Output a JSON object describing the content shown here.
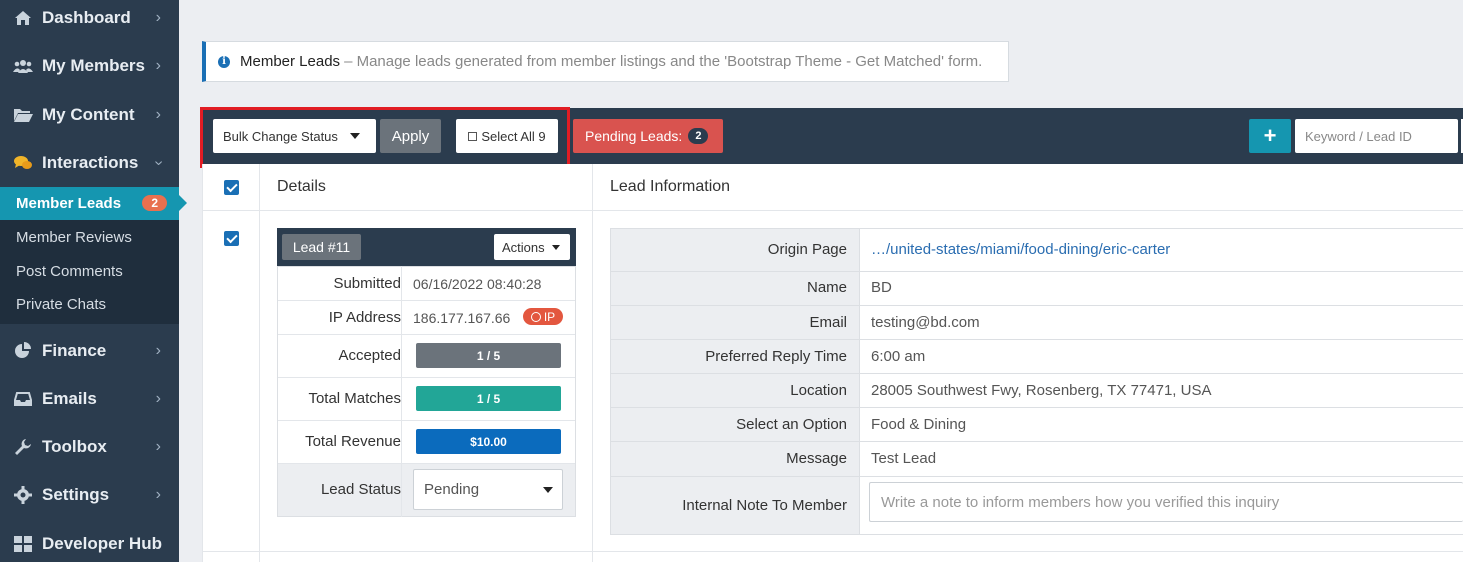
{
  "sidebar": {
    "items": [
      {
        "label": "Dashboard",
        "icon": "home-icon"
      },
      {
        "label": "My Members",
        "icon": "users-icon"
      },
      {
        "label": "My Content",
        "icon": "folder-icon"
      },
      {
        "label": "Interactions",
        "icon": "chat-icon"
      },
      {
        "label": "Finance",
        "icon": "pie-chart-icon"
      },
      {
        "label": "Emails",
        "icon": "inbox-icon"
      },
      {
        "label": "Toolbox",
        "icon": "wrench-icon"
      },
      {
        "label": "Settings",
        "icon": "gear-icon"
      },
      {
        "label": "Developer Hub",
        "icon": "grid-icon"
      }
    ],
    "submenu": [
      {
        "label": "Member Leads",
        "badge": "2"
      },
      {
        "label": "Member Reviews"
      },
      {
        "label": "Post Comments"
      },
      {
        "label": "Private Chats"
      }
    ]
  },
  "info": {
    "title": "Member Leads",
    "description": "– Manage leads generated from member listings and the 'Bootstrap Theme - Get Matched' form."
  },
  "toolbar": {
    "bulk_select": "Bulk Change Status",
    "apply": "Apply",
    "select_all": "Select All 9",
    "pending_label": "Pending Leads:",
    "pending_count": "2",
    "add": "+",
    "search_placeholder": "Keyword / Lead ID"
  },
  "table": {
    "col_details": "Details",
    "col_info": "Lead Information"
  },
  "lead": {
    "tag": "Lead #11",
    "actions": "Actions",
    "submitted_label": "Submitted",
    "submitted": "06/16/2022 08:40:28",
    "ip_label": "IP Address",
    "ip": "186.177.167.66",
    "ip_badge": "IP",
    "accepted_label": "Accepted",
    "accepted": "1 / 5",
    "matches_label": "Total Matches",
    "matches": "1 / 5",
    "revenue_label": "Total Revenue",
    "revenue": "$10.00",
    "status_label": "Lead Status",
    "status": "Pending"
  },
  "colors": {
    "accepted": "#6b737b",
    "matches": "#22a697",
    "revenue": "#0b6bbd"
  },
  "lead_info": {
    "rows": [
      {
        "label": "Origin Page",
        "value": "…/united-states/miami/food-dining/eric-carter"
      },
      {
        "label": "Name",
        "value": "BD"
      },
      {
        "label": "Email",
        "value": "testing@bd.com"
      },
      {
        "label": "Preferred Reply Time",
        "value": "6:00 am"
      },
      {
        "label": "Location",
        "value": "28005 Southwest Fwy, Rosenberg, TX 77471, USA"
      },
      {
        "label": "Select an Option",
        "value": "Food & Dining"
      },
      {
        "label": "Message",
        "value": "Test Lead"
      },
      {
        "label": "Internal Note To Member",
        "value": ""
      }
    ],
    "note_placeholder": "Write a note to inform members how you verified this inquiry"
  }
}
